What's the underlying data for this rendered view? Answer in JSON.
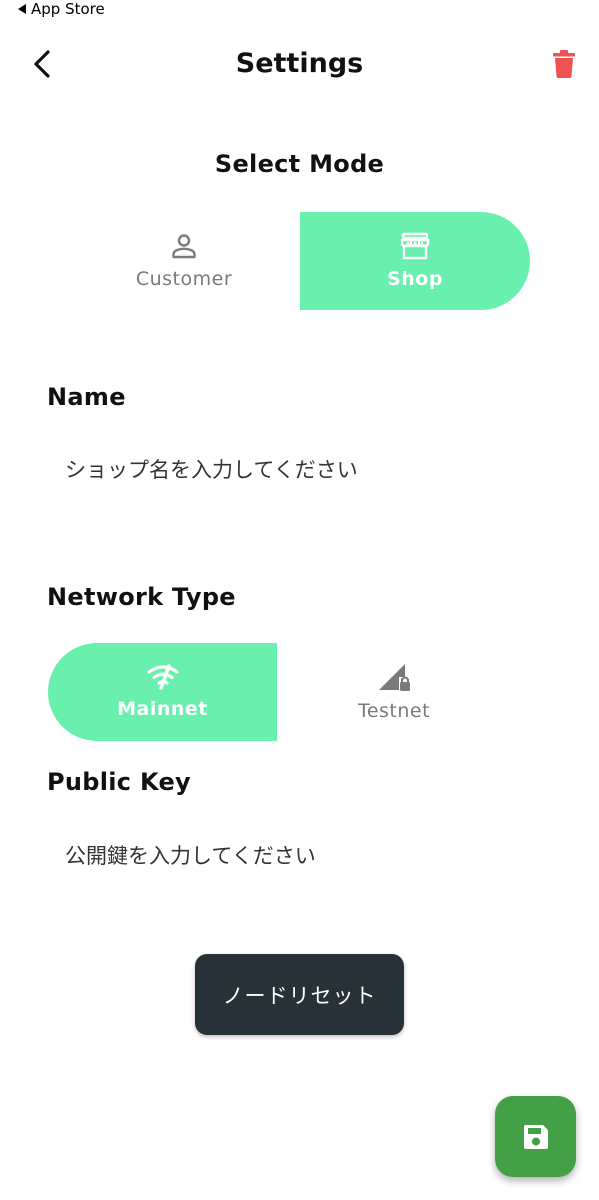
{
  "status_bar": {
    "back_app": "App Store"
  },
  "app_bar": {
    "title": "Settings",
    "back_icon": "chevron-left-icon",
    "delete_icon": "trash-icon",
    "delete_color": "#f05151"
  },
  "mode": {
    "title": "Select Mode",
    "options": [
      {
        "label": "Customer",
        "icon": "person-icon",
        "selected": false
      },
      {
        "label": "Shop",
        "icon": "store-icon",
        "selected": true
      }
    ]
  },
  "name_field": {
    "label": "Name",
    "placeholder": "ショップ名を入力してください"
  },
  "network": {
    "label": "Network Type",
    "options": [
      {
        "label": "Mainnet",
        "icon": "network-check-icon",
        "selected": true
      },
      {
        "label": "Testnet",
        "icon": "signal-locked-icon",
        "selected": false
      }
    ]
  },
  "public_key_field": {
    "label": "Public Key",
    "placeholder": "公開鍵を入力してください"
  },
  "reset_button": {
    "label": "ノードリセット"
  },
  "save_fab": {
    "icon": "save-icon"
  },
  "colors": {
    "accent": "#69f0ae",
    "reset_button_bg": "#263238",
    "fab_bg": "#43a047"
  }
}
